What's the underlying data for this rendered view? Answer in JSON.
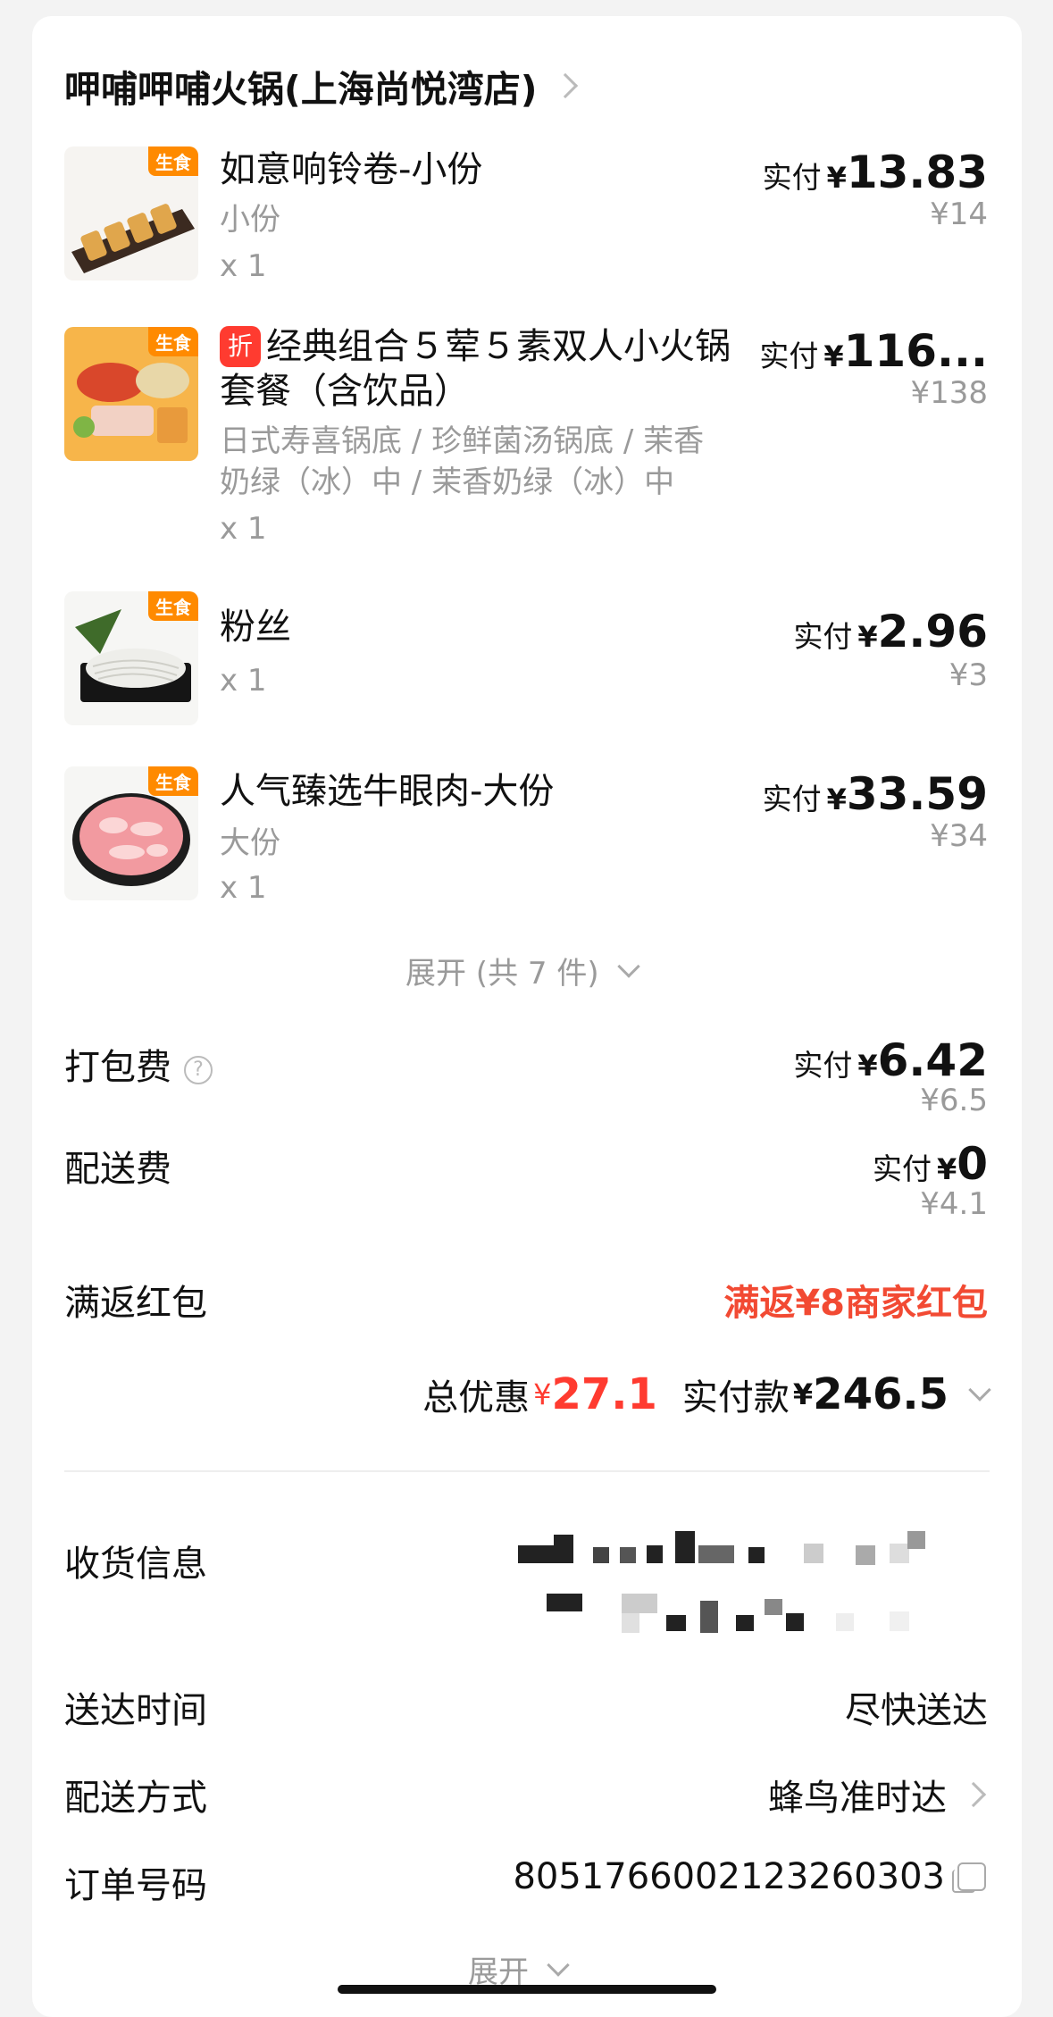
{
  "store": {
    "name": "呷哺呷哺火锅(上海尚悦湾店)"
  },
  "items": [
    {
      "tag": "生食",
      "name": "如意响铃卷-小份",
      "spec": "小份",
      "qty": "x 1",
      "pay_label": "实付",
      "currency": "¥",
      "paid": "13.83",
      "original": "¥14"
    },
    {
      "tag": "生食",
      "discount_badge": "折",
      "name_line1": "经典组合５荤５素双人小火锅",
      "name_line2": "套餐（含饮品）",
      "spec_line1": "日式寿喜锅底 / 珍鲜菌汤锅底 / 茉香",
      "spec_line2": "奶绿（冰）中 / 茉香奶绿（冰）中",
      "qty": "x 1",
      "pay_label": "实付",
      "currency": "¥",
      "paid": "116...",
      "original": "¥138"
    },
    {
      "tag": "生食",
      "name": "粉丝",
      "qty": "x 1",
      "pay_label": "实付",
      "currency": "¥",
      "paid": "2.96",
      "original": "¥3"
    },
    {
      "tag": "生食",
      "name": "人气臻选牛眼肉-大份",
      "spec": "大份",
      "qty": "x 1",
      "pay_label": "实付",
      "currency": "¥",
      "paid": "33.59",
      "original": "¥34"
    }
  ],
  "expand_items": "展开 (共 7 件)",
  "packing": {
    "label": "打包费",
    "help": "?",
    "pay_label": "实付",
    "currency": "¥",
    "paid": "6.42",
    "original": "¥6.5"
  },
  "delivery_fee": {
    "label": "配送费",
    "pay_label": "实付",
    "currency": "¥",
    "paid": "0",
    "original": "¥4.1"
  },
  "red_packet": {
    "label": "满返红包",
    "value": "满返¥8商家红包"
  },
  "summary": {
    "discount_label": "总优惠",
    "currency": "¥",
    "discount": "27.1",
    "paid_label": "实付款",
    "paid": "246.5"
  },
  "info": {
    "address_label": "收货信息",
    "time_label": "送达时间",
    "time_value": "尽快送达",
    "method_label": "配送方式",
    "method_value": "蜂鸟准时达",
    "order_label": "订单号码",
    "order_value": "8051766002123260303"
  },
  "expand_more": "展开",
  "colors": {
    "accent_red": "#ff3b30",
    "promo_red": "#f24a33",
    "tag_orange": "#ff8a00",
    "muted": "#9a9a9a"
  }
}
